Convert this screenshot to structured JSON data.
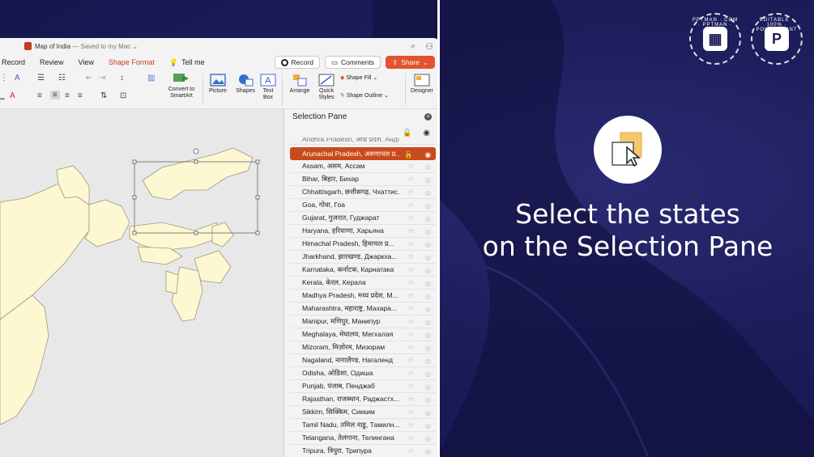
{
  "window": {
    "doc_title": "Map of India",
    "doc_status": "— Saved to my Mac",
    "search_icon": "search-icon",
    "share_people_icon": "share-people-icon"
  },
  "menu": {
    "tabs": [
      "Record",
      "Review",
      "View",
      "Shape Format"
    ],
    "active_tab": "Shape Format",
    "tell_me": "Tell me",
    "record_btn": "Record",
    "comments_btn": "Comments",
    "share_btn": "Share"
  },
  "ribbon": {
    "convert_smartart": "Convert to SmartArt",
    "picture": "Picture",
    "shapes": "Shapes",
    "text_box": "Text Box",
    "arrange": "Arrange",
    "quick_styles": "Quick Styles",
    "shape_fill": "Shape Fill",
    "shape_outline": "Shape Outline",
    "designer": "Designer"
  },
  "pane": {
    "title": "Selection Pane",
    "partial_top": "Andhra Pradesh, आंध्र प्रदेश, Андхра...",
    "selected_item": "Arunachal Pradesh, अरुणाचल प्र...",
    "items": [
      "Assam, असम, Ассам",
      "Bihar, बिहार, Бихар",
      "Chhattisgarh, छत्तीसगढ़, Чхаттис...",
      "Goa, गोवा, Гоа",
      "Gujarat, गुजरात, Гуджарат",
      "Haryana, हरियाणा, Харьяна",
      "Himachal Pradesh, हिमाचल प्र...",
      "Jharkhand, झारखण्ड, Джаркха...",
      "Karnataka, कर्नाटक, Карнатака",
      "Kerala, केरल, Керала",
      "Madhya Pradesh, मध्य प्रदेश, М...",
      "Maharashtra, महाराष्ट्र, Махара...",
      "Manipur, मणिपुर, Манипур",
      "Meghalaya, मेघालय, Мегхалая",
      "Mizoram, मिज़ोरम, Мизорам",
      "Nagaland, नागालैण्ड, Нагаленд",
      "Odisha, ओडिशा, Одиша",
      "Punjab, पंजाब, Пенджаб",
      "Rajasthan, राजस्थान, Раджастх...",
      "Sikkim, सिक्किम, Сикким",
      "Tamil Nadu, तमिल नाडु, Тамилн...",
      "Telangana, तेलंगाना, Телингана",
      "Tripura, त्रिपुरा, Трипура"
    ]
  },
  "promo": {
    "heading_line1": "Select the states",
    "heading_line2": "on the Selection Pane",
    "badge1_text": "PPTMAN · COM · PPTMAN · COM",
    "badge2_text": "EDITABLE · 100% · POWERPOINT",
    "badge2_letter": "P"
  },
  "colors": {
    "accent": "#c94a1c",
    "background": "#1a1a55",
    "map_fill": "#fdf7d2"
  }
}
